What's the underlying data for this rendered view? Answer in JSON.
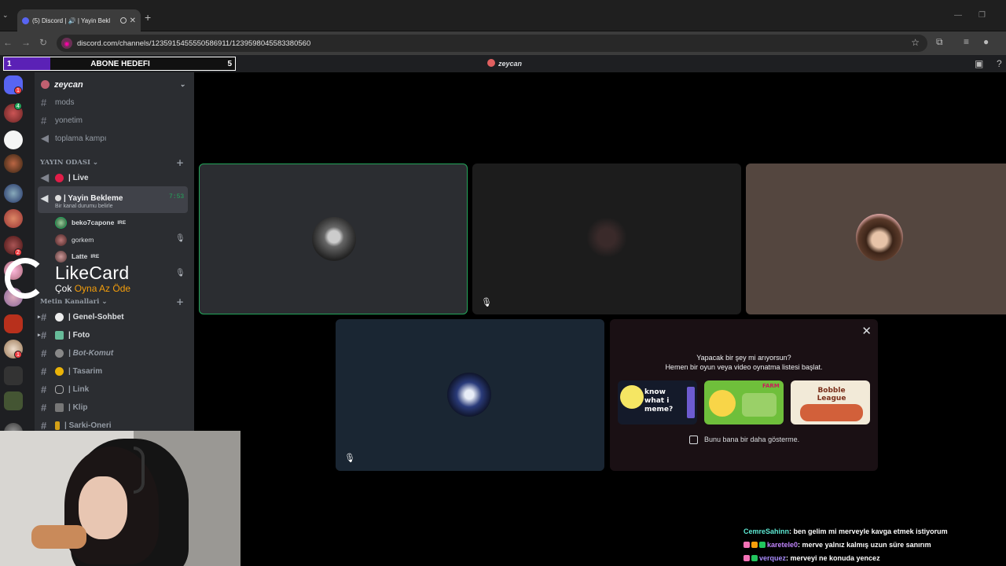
{
  "browser": {
    "tab_title": "(5) Discord | 🔊 | Yayin Bekl",
    "url": "discord.com/channels/1235915455550586911/1239598045583380560"
  },
  "overlay": {
    "goal_start": "1",
    "goal_label": "ABONE HEDEFI",
    "goal_end": "5",
    "goal_progress": 0.2
  },
  "discord": {
    "channel_title": "zeycan",
    "server_name": "zeycan",
    "top_channels": [
      "mods",
      "yonetim",
      "toplama kampı"
    ],
    "voice_category": "YAYIN ODASI",
    "voice_channels": [
      {
        "label": "| Live"
      },
      {
        "label": "| Yayin Bekleme",
        "time": "7:53",
        "status": "Bir kanal durumu belirle"
      }
    ],
    "voice_users": [
      {
        "name": "beko7capone",
        "tag": "IRE"
      },
      {
        "name": "gorkem",
        "tag": ""
      },
      {
        "name": "Latte",
        "tag": "IRE"
      }
    ],
    "text_category": "Metin Kanallari",
    "text_channels": [
      "| Genel-Sohbet",
      "| Foto",
      "| Bot-Komut",
      "| Tasarim",
      "| Link",
      "| Klip",
      "| Sarki-Oneri"
    ]
  },
  "likecard": {
    "name": "LikeCard",
    "slogan_1": "Çok",
    "slogan_2": "Oyna",
    "slogan_3": "Az Öde"
  },
  "promo": {
    "line1": "Yapacak bir şey mi arıyorsun?",
    "line2": "Hemen bir oyun veya video oynatma listesi başlat.",
    "game1_text": "know what i meme?",
    "game2_text": "FARM",
    "game3_text": "Bobble League",
    "checkbox_label": "Bunu bana bir daha gösterme."
  },
  "chat": [
    {
      "user": "CemreSahinn",
      "text": ": ben gelim mi merveyle kavga etmek istiyorum"
    },
    {
      "user": "karetele0",
      "text": ": merve yalnız kalmış uzun süre sanırım"
    },
    {
      "user": "verquez",
      "text": ": merveyi ne konuda yencez"
    }
  ],
  "colors": {
    "accent": "#5865f2",
    "speaking": "#23a55a",
    "goal_fill": "#5b21b6"
  }
}
